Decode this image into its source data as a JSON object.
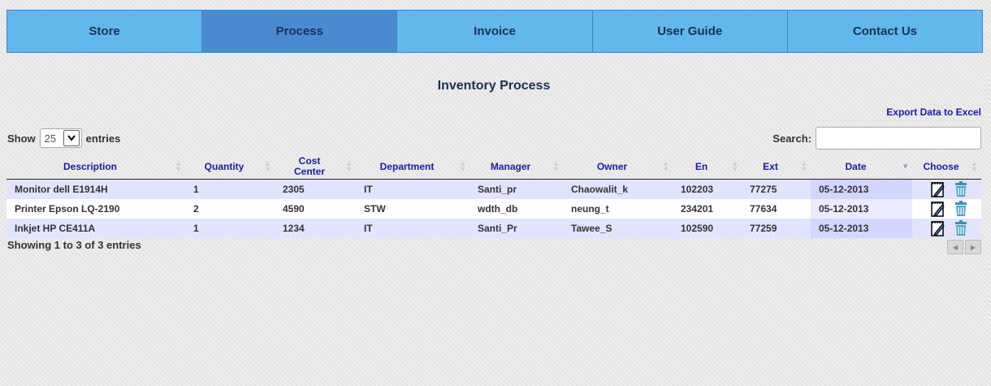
{
  "nav": [
    {
      "label": "Store"
    },
    {
      "label": "Process"
    },
    {
      "label": "Invoice"
    },
    {
      "label": "User Guide"
    },
    {
      "label": "Contact Us"
    }
  ],
  "page_title": "Inventory Process",
  "export_label": "Export Data to Excel",
  "length": {
    "show": "Show",
    "value": "25",
    "entries": "entries"
  },
  "search": {
    "label": "Search:",
    "value": ""
  },
  "table": {
    "columns": [
      "Description",
      "Quantity",
      "Cost Center",
      "Department",
      "Manager",
      "Owner",
      "En",
      "Ext",
      "Date",
      "Choose"
    ],
    "sorted_column": "Date",
    "rows": [
      {
        "description": "Monitor dell E1914H",
        "quantity": "1",
        "cost_center": "2305",
        "department": "IT",
        "manager": "Santi_pr",
        "owner": "Chaowalit_k",
        "en": "102203",
        "ext": "77275",
        "date": "05-12-2013"
      },
      {
        "description": "Printer Epson LQ-2190",
        "quantity": "2",
        "cost_center": "4590",
        "department": "STW",
        "manager": "wdth_db",
        "owner": "neung_t",
        "en": "234201",
        "ext": "77634",
        "date": "05-12-2013"
      },
      {
        "description": "Inkjet HP CE411A",
        "quantity": "1",
        "cost_center": "1234",
        "department": "IT",
        "manager": "Santi_Pr",
        "owner": "Tawee_S",
        "en": "102590",
        "ext": "77259",
        "date": "05-12-2013"
      }
    ]
  },
  "info": "Showing 1 to 3 of 3 entries",
  "icons": {
    "edit": "edit-icon",
    "delete": "trash-icon",
    "prev": "prev-page-icon",
    "next": "next-page-icon"
  },
  "colors": {
    "nav": "#62b8ec",
    "nav_active": "#4a8ad0",
    "header_text": "#1a1aa8",
    "row_odd": "#e2e4ff"
  }
}
